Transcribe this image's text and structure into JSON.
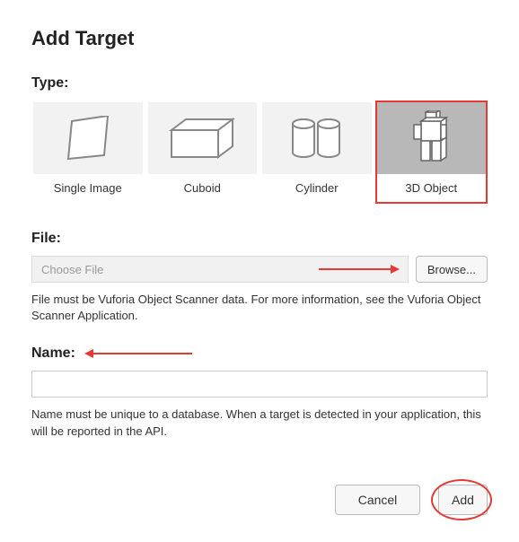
{
  "title": "Add Target",
  "type_section": {
    "label": "Type:",
    "options": [
      {
        "label": "Single Image",
        "icon": "single-image-icon"
      },
      {
        "label": "Cuboid",
        "icon": "cuboid-icon"
      },
      {
        "label": "Cylinder",
        "icon": "cylinder-icon"
      },
      {
        "label": "3D Object",
        "icon": "3d-object-icon"
      }
    ],
    "selected_index": 3
  },
  "file_section": {
    "label": "File:",
    "placeholder": "Choose File",
    "browse_label": "Browse...",
    "help": "File must be Vuforia Object Scanner data. For more information, see the Vuforia Object Scanner Application."
  },
  "name_section": {
    "label": "Name:",
    "value": "",
    "help": "Name must be unique to a database. When a target is detected in your application, this will be reported in the API."
  },
  "footer": {
    "cancel_label": "Cancel",
    "add_label": "Add"
  }
}
